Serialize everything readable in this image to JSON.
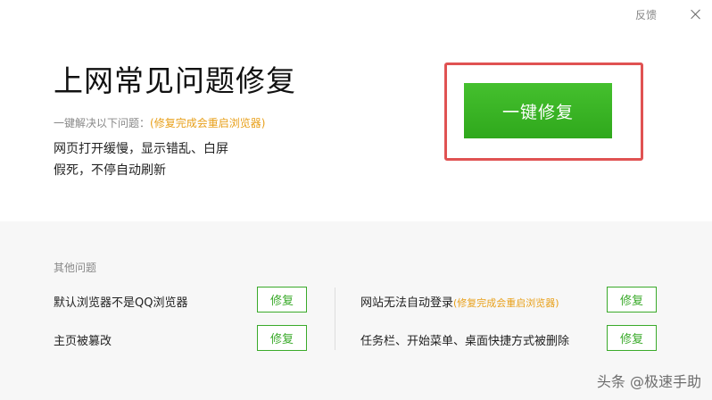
{
  "header": {
    "feedback_label": "反馈"
  },
  "hero": {
    "title": "上网常见问题修复",
    "subtitle_prefix": "一键解决以下问题：",
    "subtitle_note": "(修复完成会重启浏览器)",
    "line1": "网页打开缓慢，显示错乱、白屏",
    "line2": "假死，不停自动刷新",
    "repair_button": "一键修复"
  },
  "other": {
    "title": "其他问题",
    "items": [
      {
        "label": "默认浏览器不是QQ浏览器",
        "note": "",
        "button": "修复"
      },
      {
        "label": "网站无法自动登录",
        "note": "(修复完成会重启浏览器)",
        "button": "修复"
      },
      {
        "label": "主页被篡改",
        "note": "",
        "button": "修复"
      },
      {
        "label": "任务栏、开始菜单、桌面快捷方式被删除",
        "note": "",
        "button": "修复"
      }
    ]
  },
  "watermark": "头条 @极速手助"
}
